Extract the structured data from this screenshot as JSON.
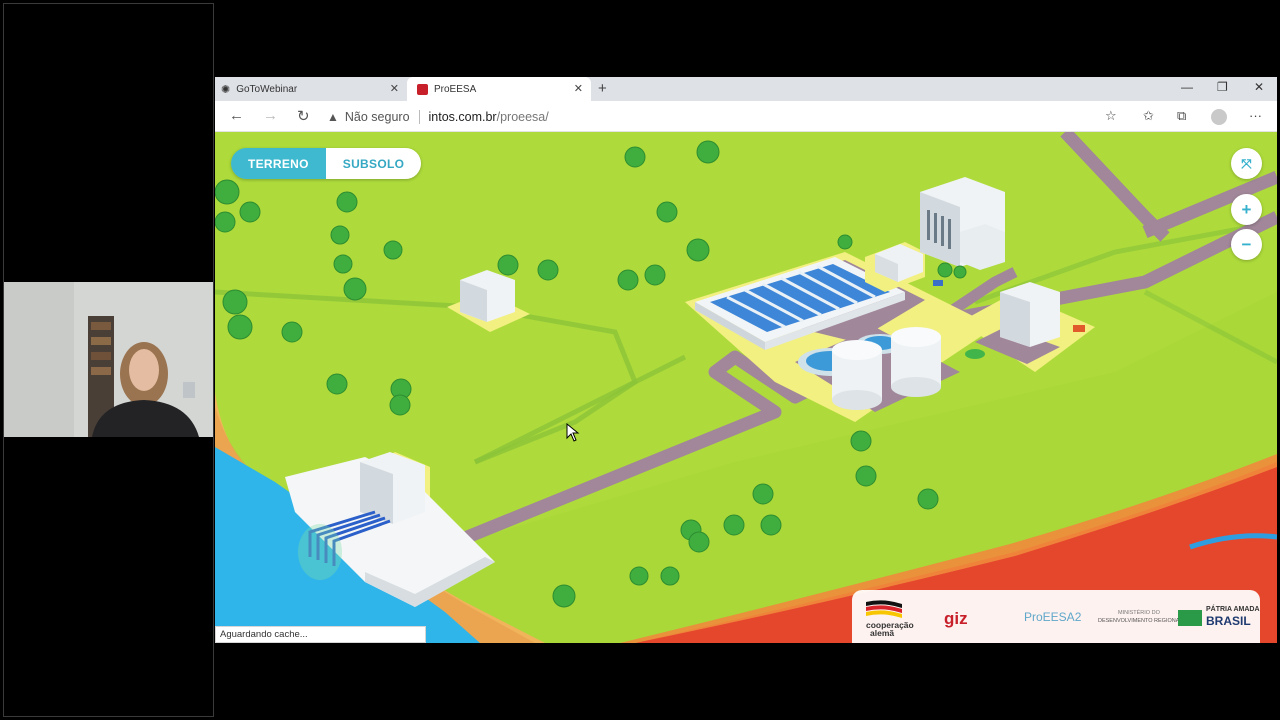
{
  "webinar": {
    "tab_title": "GoToWebinar"
  },
  "browser": {
    "tabs": [
      {
        "title": "GoToWebinar",
        "icon": "gotowebinar-icon"
      },
      {
        "title": "ProEESA",
        "icon": "proeesa-favicon-icon",
        "active": true
      }
    ],
    "new_tab": "+",
    "window_controls": {
      "minimize": "—",
      "restore": "❐",
      "close": "✕"
    },
    "security_label": "Não seguro",
    "url_host": "intos.com.br",
    "url_path": "/proeesa/",
    "status_text": "Aguardando cache..."
  },
  "map": {
    "mode_toggle": [
      {
        "label": "TERRENO",
        "active": true
      },
      {
        "label": "SUBSOLO",
        "active": false
      }
    ],
    "controls": [
      "fullscreen-icon",
      "zoom-in-icon",
      "zoom-out-icon"
    ],
    "zoom_in": "+",
    "zoom_out": "−"
  },
  "logos": {
    "cooperacao_line1": "cooperação",
    "cooperacao_line2": "alemã",
    "giz": "giz",
    "proeesa2": "ProEESA2",
    "ministerio_line1": "MINISTÉRIO DO",
    "ministerio_line2": "DESENVOLVIMENTO REGIONAL",
    "patria_line1": "PÁTRIA AMADA",
    "patria_line2": "BRASIL"
  },
  "colors": {
    "accent": "#3fb9cf",
    "grass": "#a9d838",
    "water": "#2fb5e9",
    "road": "#a18799",
    "clay": "#e2472c",
    "tab_bar": "#dee1e6"
  }
}
